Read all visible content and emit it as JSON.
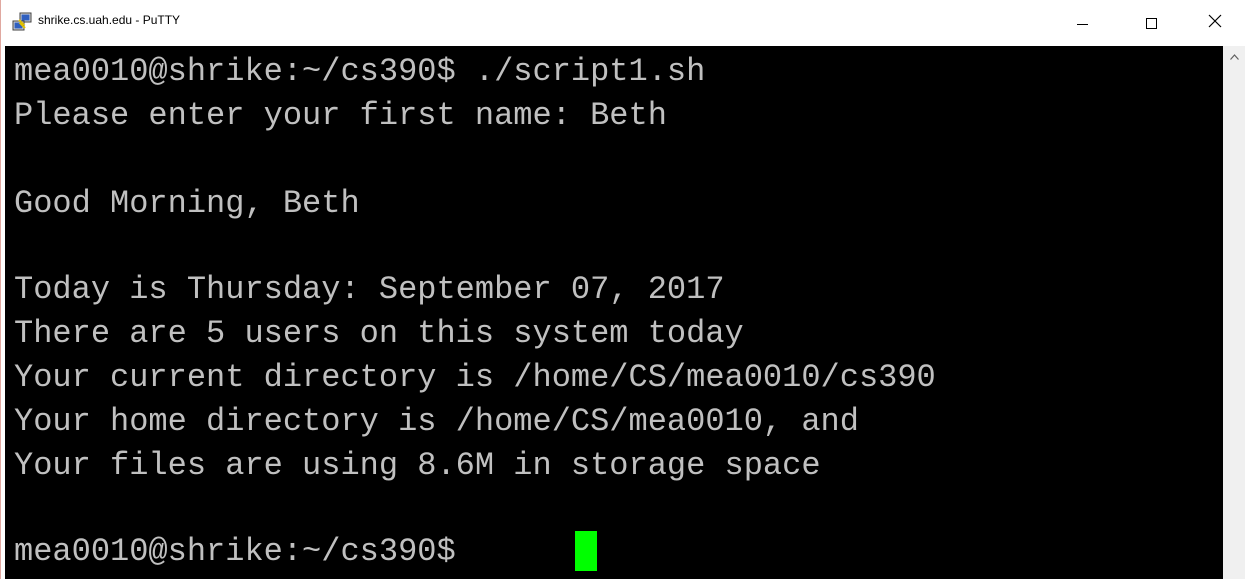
{
  "window": {
    "title": "shrike.cs.uah.edu - PuTTY",
    "icon": "putty-icon",
    "controls": {
      "minimize": "minimize-icon",
      "maximize": "maximize-icon",
      "close": "close-icon",
      "close_glyph": "✕"
    }
  },
  "terminal": {
    "colors": {
      "background": "#000000",
      "foreground": "#c0c0c0",
      "cursor": "#00ff00"
    },
    "lines": [
      "mea0010@shrike:~/cs390$ ./script1.sh",
      "Please enter your first name: Beth",
      "",
      "Good Morning, Beth",
      "",
      "Today is Thursday: September 07, 2017",
      "There are 5 users on this system today",
      "Your current directory is /home/CS/mea0010/cs390",
      "Your home directory is /home/CS/mea0010, and",
      "Your files are using 8.6M in storage space",
      "",
      "mea0010@shrike:~/cs390$ "
    ]
  },
  "scrollbar": {
    "up_arrow": "^"
  }
}
